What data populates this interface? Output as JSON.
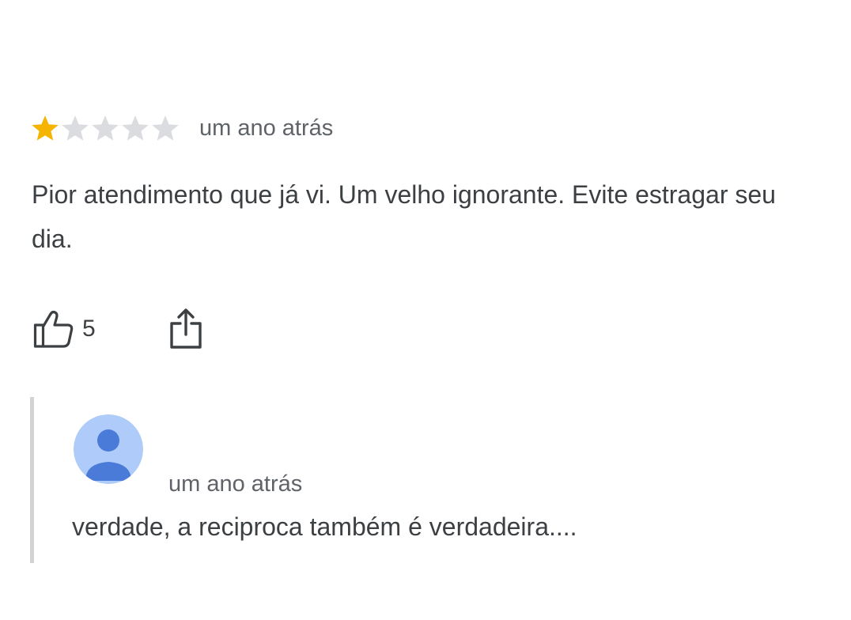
{
  "review": {
    "rating": 1,
    "max_rating": 5,
    "star_colors": {
      "filled": "#f4b400",
      "empty": "#dadce0"
    },
    "timestamp": "um ano atrás",
    "text": "Pior atendimento que já vi. Um velho ignorante. Evite estragar seu dia.",
    "actions": {
      "like_icon": "thumbs-up-icon",
      "like_count": "5",
      "share_icon": "share-icon"
    }
  },
  "reply": {
    "avatar_icon": "person-icon",
    "avatar_colors": {
      "background": "#aecbfa",
      "figure": "#4a7bd9"
    },
    "timestamp": "um ano atrás",
    "text": "verdade, a reciproca também é verdadeira...."
  }
}
